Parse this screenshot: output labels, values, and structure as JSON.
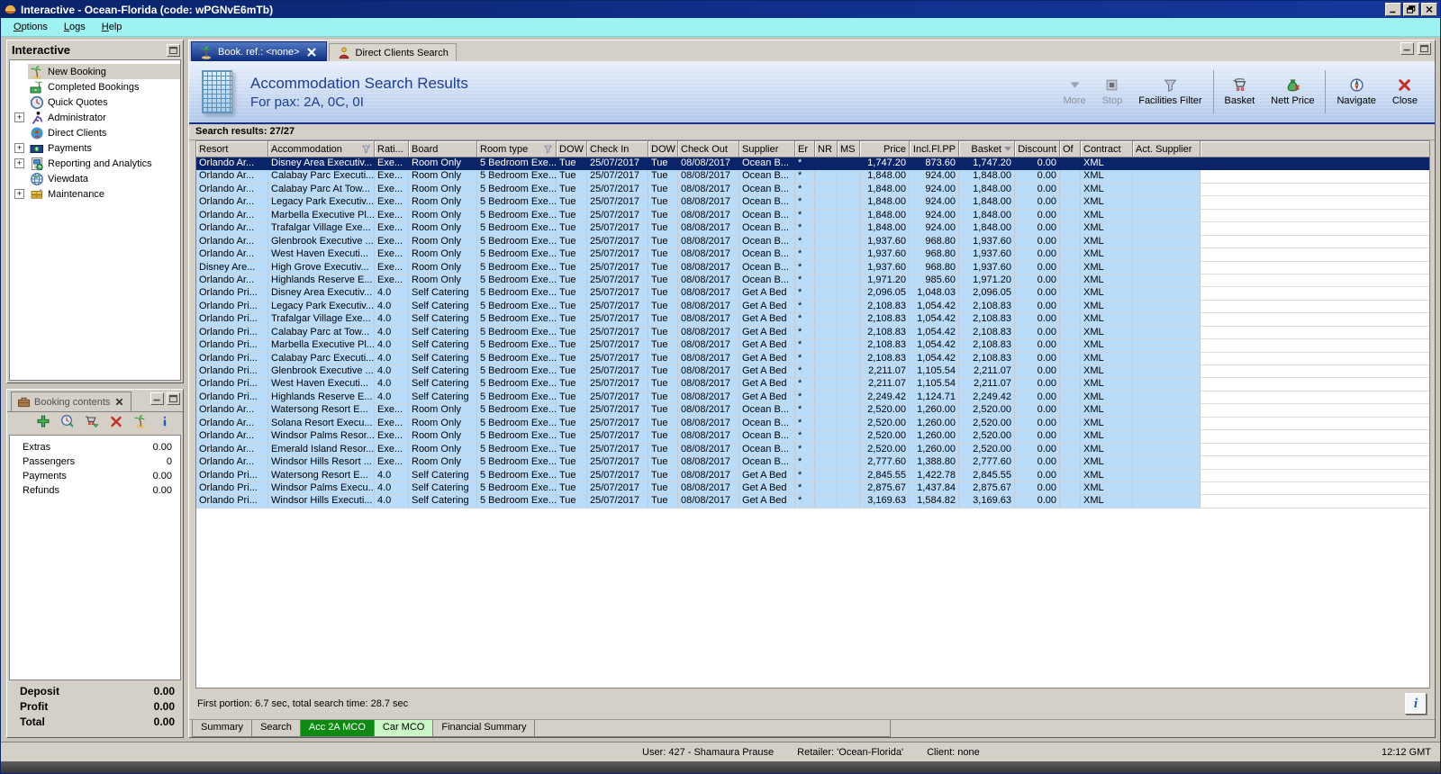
{
  "window": {
    "title": "Interactive - Ocean-Florida (code: wPGNvE6mTb)"
  },
  "menu": {
    "items": [
      {
        "label": "Options"
      },
      {
        "label": "Logs"
      },
      {
        "label": "Help"
      }
    ]
  },
  "sidebar": {
    "title": "Interactive",
    "items": [
      {
        "label": "New Booking",
        "icon": "palm",
        "selected": true
      },
      {
        "label": "Completed Bookings",
        "icon": "completed"
      },
      {
        "label": "Quick Quotes",
        "icon": "clock"
      },
      {
        "label": "Administrator",
        "icon": "admin",
        "expandable": true
      },
      {
        "label": "Direct Clients",
        "icon": "clients"
      },
      {
        "label": "Payments",
        "icon": "payments",
        "expandable": true
      },
      {
        "label": "Reporting and Analytics",
        "icon": "reporting",
        "expandable": true
      },
      {
        "label": "Viewdata",
        "icon": "globe"
      },
      {
        "label": "Maintenance",
        "icon": "maintenance",
        "expandable": true
      }
    ]
  },
  "booking_contents": {
    "title": "Booking contents",
    "toolbar_icons": [
      "add",
      "quote",
      "cart-add",
      "delete",
      "palm",
      "info"
    ],
    "rows": [
      [
        "Extras",
        "0.00"
      ],
      [
        "Passengers",
        "0"
      ],
      [
        "Payments",
        "0.00"
      ],
      [
        "Refunds",
        "0.00"
      ]
    ],
    "totals": [
      [
        "Deposit",
        "0.00"
      ],
      [
        "Profit",
        "0.00"
      ],
      [
        "Total",
        "0.00"
      ]
    ]
  },
  "main": {
    "tabs": [
      {
        "label": "Book. ref.: <none>",
        "icon": "palm",
        "closable": true,
        "active": true
      },
      {
        "label": "Direct Clients Search",
        "icon": "client-search",
        "active": false
      }
    ],
    "header": {
      "title": "Accommodation Search Results",
      "subtitle": "For pax: 2A, 0C, 0I"
    },
    "toolbar": [
      {
        "label": "More",
        "icon": "more",
        "disabled": true
      },
      {
        "label": "Stop",
        "icon": "stop",
        "disabled": true
      },
      {
        "label": "Facilities Filter",
        "icon": "funnel"
      },
      {
        "label": "Basket",
        "icon": "basket",
        "sep_before": true
      },
      {
        "label": "Nett Price",
        "icon": "nett"
      },
      {
        "label": "Navigate",
        "icon": "navigate",
        "sep_before": true
      },
      {
        "label": "Close",
        "icon": "close"
      }
    ],
    "results_label": "Search results: 27/27",
    "table": {
      "selected_index": 0,
      "headers": [
        {
          "label": "Resort"
        },
        {
          "label": "Accommodation",
          "filter": true
        },
        {
          "label": "Rati..."
        },
        {
          "label": "Board"
        },
        {
          "label": "Room type",
          "filter": true
        },
        {
          "label": "DOW"
        },
        {
          "label": "Check In"
        },
        {
          "label": "DOW"
        },
        {
          "label": "Check Out"
        },
        {
          "label": "Supplier"
        },
        {
          "label": "Er"
        },
        {
          "label": "NR"
        },
        {
          "label": "MS"
        },
        {
          "label": "Price"
        },
        {
          "label": "Incl.Fl.PP"
        },
        {
          "label": "Basket",
          "sort": true
        },
        {
          "label": "Discount"
        },
        {
          "label": "Of"
        },
        {
          "label": "Contract"
        },
        {
          "label": "Act. Supplier"
        }
      ],
      "rows": [
        [
          "Orlando Ar...",
          "Disney Area Executiv...",
          "Exe...",
          "Room Only",
          "5 Bedroom Exe...",
          "Tue",
          "25/07/2017",
          "Tue",
          "08/08/2017",
          "Ocean B...",
          "*",
          "",
          "",
          "1,747.20",
          "873.60",
          "1,747.20",
          "0.00",
          "",
          "XML",
          ""
        ],
        [
          "Orlando Ar...",
          "Calabay Parc Executi...",
          "Exe...",
          "Room Only",
          "5 Bedroom Exe...",
          "Tue",
          "25/07/2017",
          "Tue",
          "08/08/2017",
          "Ocean B...",
          "*",
          "",
          "",
          "1,848.00",
          "924.00",
          "1,848.00",
          "0.00",
          "",
          "XML",
          ""
        ],
        [
          "Orlando Ar...",
          "Calabay Parc At Tow...",
          "Exe...",
          "Room Only",
          "5 Bedroom Exe...",
          "Tue",
          "25/07/2017",
          "Tue",
          "08/08/2017",
          "Ocean B...",
          "*",
          "",
          "",
          "1,848.00",
          "924.00",
          "1,848.00",
          "0.00",
          "",
          "XML",
          ""
        ],
        [
          "Orlando Ar...",
          "Legacy Park Executiv...",
          "Exe...",
          "Room Only",
          "5 Bedroom Exe...",
          "Tue",
          "25/07/2017",
          "Tue",
          "08/08/2017",
          "Ocean B...",
          "*",
          "",
          "",
          "1,848.00",
          "924.00",
          "1,848.00",
          "0.00",
          "",
          "XML",
          ""
        ],
        [
          "Orlando Ar...",
          "Marbella Executive Pl...",
          "Exe...",
          "Room Only",
          "5 Bedroom Exe...",
          "Tue",
          "25/07/2017",
          "Tue",
          "08/08/2017",
          "Ocean B...",
          "*",
          "",
          "",
          "1,848.00",
          "924.00",
          "1,848.00",
          "0.00",
          "",
          "XML",
          ""
        ],
        [
          "Orlando Ar...",
          "Trafalgar Village Exe...",
          "Exe...",
          "Room Only",
          "5 Bedroom Exe...",
          "Tue",
          "25/07/2017",
          "Tue",
          "08/08/2017",
          "Ocean B...",
          "*",
          "",
          "",
          "1,848.00",
          "924.00",
          "1,848.00",
          "0.00",
          "",
          "XML",
          ""
        ],
        [
          "Orlando Ar...",
          "Glenbrook Executive ...",
          "Exe...",
          "Room Only",
          "5 Bedroom Exe...",
          "Tue",
          "25/07/2017",
          "Tue",
          "08/08/2017",
          "Ocean B...",
          "*",
          "",
          "",
          "1,937.60",
          "968.80",
          "1,937.60",
          "0.00",
          "",
          "XML",
          ""
        ],
        [
          "Orlando Ar...",
          "West Haven Executi...",
          "Exe...",
          "Room Only",
          "5 Bedroom Exe...",
          "Tue",
          "25/07/2017",
          "Tue",
          "08/08/2017",
          "Ocean B...",
          "*",
          "",
          "",
          "1,937.60",
          "968.80",
          "1,937.60",
          "0.00",
          "",
          "XML",
          ""
        ],
        [
          "Disney Are...",
          "High Grove Executiv...",
          "Exe...",
          "Room Only",
          "5 Bedroom Exe...",
          "Tue",
          "25/07/2017",
          "Tue",
          "08/08/2017",
          "Ocean B...",
          "*",
          "",
          "",
          "1,937.60",
          "968.80",
          "1,937.60",
          "0.00",
          "",
          "XML",
          ""
        ],
        [
          "Orlando Ar...",
          "Highlands Reserve E...",
          "Exe...",
          "Room Only",
          "5 Bedroom Exe...",
          "Tue",
          "25/07/2017",
          "Tue",
          "08/08/2017",
          "Ocean B...",
          "*",
          "",
          "",
          "1,971.20",
          "985.60",
          "1,971.20",
          "0.00",
          "",
          "XML",
          ""
        ],
        [
          "Orlando Pri...",
          "Disney Area Executiv...",
          "4.0",
          "Self Catering",
          "5 Bedroom Exe...",
          "Tue",
          "25/07/2017",
          "Tue",
          "08/08/2017",
          "Get A Bed",
          "*",
          "",
          "",
          "2,096.05",
          "1,048.03",
          "2,096.05",
          "0.00",
          "",
          "XML",
          ""
        ],
        [
          "Orlando Pri...",
          "Legacy Park Executiv...",
          "4.0",
          "Self Catering",
          "5 Bedroom Exe...",
          "Tue",
          "25/07/2017",
          "Tue",
          "08/08/2017",
          "Get A Bed",
          "*",
          "",
          "",
          "2,108.83",
          "1,054.42",
          "2,108.83",
          "0.00",
          "",
          "XML",
          ""
        ],
        [
          "Orlando Pri...",
          "Trafalgar Village Exe...",
          "4.0",
          "Self Catering",
          "5 Bedroom Exe...",
          "Tue",
          "25/07/2017",
          "Tue",
          "08/08/2017",
          "Get A Bed",
          "*",
          "",
          "",
          "2,108.83",
          "1,054.42",
          "2,108.83",
          "0.00",
          "",
          "XML",
          ""
        ],
        [
          "Orlando Pri...",
          "Calabay Parc at Tow...",
          "4.0",
          "Self Catering",
          "5 Bedroom Exe...",
          "Tue",
          "25/07/2017",
          "Tue",
          "08/08/2017",
          "Get A Bed",
          "*",
          "",
          "",
          "2,108.83",
          "1,054.42",
          "2,108.83",
          "0.00",
          "",
          "XML",
          ""
        ],
        [
          "Orlando Pri...",
          "Marbella Executive Pl...",
          "4.0",
          "Self Catering",
          "5 Bedroom Exe...",
          "Tue",
          "25/07/2017",
          "Tue",
          "08/08/2017",
          "Get A Bed",
          "*",
          "",
          "",
          "2,108.83",
          "1,054.42",
          "2,108.83",
          "0.00",
          "",
          "XML",
          ""
        ],
        [
          "Orlando Pri...",
          "Calabay Parc Executi...",
          "4.0",
          "Self Catering",
          "5 Bedroom Exe...",
          "Tue",
          "25/07/2017",
          "Tue",
          "08/08/2017",
          "Get A Bed",
          "*",
          "",
          "",
          "2,108.83",
          "1,054.42",
          "2,108.83",
          "0.00",
          "",
          "XML",
          ""
        ],
        [
          "Orlando Pri...",
          "Glenbrook Executive ...",
          "4.0",
          "Self Catering",
          "5 Bedroom Exe...",
          "Tue",
          "25/07/2017",
          "Tue",
          "08/08/2017",
          "Get A Bed",
          "*",
          "",
          "",
          "2,211.07",
          "1,105.54",
          "2,211.07",
          "0.00",
          "",
          "XML",
          ""
        ],
        [
          "Orlando Pri...",
          "West Haven Executi...",
          "4.0",
          "Self Catering",
          "5 Bedroom Exe...",
          "Tue",
          "25/07/2017",
          "Tue",
          "08/08/2017",
          "Get A Bed",
          "*",
          "",
          "",
          "2,211.07",
          "1,105.54",
          "2,211.07",
          "0.00",
          "",
          "XML",
          ""
        ],
        [
          "Orlando Pri...",
          "Highlands Reserve E...",
          "4.0",
          "Self Catering",
          "5 Bedroom Exe...",
          "Tue",
          "25/07/2017",
          "Tue",
          "08/08/2017",
          "Get A Bed",
          "*",
          "",
          "",
          "2,249.42",
          "1,124.71",
          "2,249.42",
          "0.00",
          "",
          "XML",
          ""
        ],
        [
          "Orlando Ar...",
          "Watersong Resort E...",
          "Exe...",
          "Room Only",
          "5 Bedroom Exe...",
          "Tue",
          "25/07/2017",
          "Tue",
          "08/08/2017",
          "Ocean B...",
          "*",
          "",
          "",
          "2,520.00",
          "1,260.00",
          "2,520.00",
          "0.00",
          "",
          "XML",
          ""
        ],
        [
          "Orlando Ar...",
          "Solana Resort Execu...",
          "Exe...",
          "Room Only",
          "5 Bedroom Exe...",
          "Tue",
          "25/07/2017",
          "Tue",
          "08/08/2017",
          "Ocean B...",
          "*",
          "",
          "",
          "2,520.00",
          "1,260.00",
          "2,520.00",
          "0.00",
          "",
          "XML",
          ""
        ],
        [
          "Orlando Ar...",
          "Windsor Palms Resor...",
          "Exe...",
          "Room Only",
          "5 Bedroom Exe...",
          "Tue",
          "25/07/2017",
          "Tue",
          "08/08/2017",
          "Ocean B...",
          "*",
          "",
          "",
          "2,520.00",
          "1,260.00",
          "2,520.00",
          "0.00",
          "",
          "XML",
          ""
        ],
        [
          "Orlando Ar...",
          "Emerald Island Resor...",
          "Exe...",
          "Room Only",
          "5 Bedroom Exe...",
          "Tue",
          "25/07/2017",
          "Tue",
          "08/08/2017",
          "Ocean B...",
          "*",
          "",
          "",
          "2,520.00",
          "1,260.00",
          "2,520.00",
          "0.00",
          "",
          "XML",
          ""
        ],
        [
          "Orlando Ar...",
          "Windsor Hills Resort ...",
          "Exe...",
          "Room Only",
          "5 Bedroom Exe...",
          "Tue",
          "25/07/2017",
          "Tue",
          "08/08/2017",
          "Ocean B...",
          "*",
          "",
          "",
          "2,777.60",
          "1,388.80",
          "2,777.60",
          "0.00",
          "",
          "XML",
          ""
        ],
        [
          "Orlando Pri...",
          "Watersong Resort E...",
          "4.0",
          "Self Catering",
          "5 Bedroom Exe...",
          "Tue",
          "25/07/2017",
          "Tue",
          "08/08/2017",
          "Get A Bed",
          "*",
          "",
          "",
          "2,845.55",
          "1,422.78",
          "2,845.55",
          "0.00",
          "",
          "XML",
          ""
        ],
        [
          "Orlando Pri...",
          "Windsor Palms Execu...",
          "4.0",
          "Self Catering",
          "5 Bedroom Exe...",
          "Tue",
          "25/07/2017",
          "Tue",
          "08/08/2017",
          "Get A Bed",
          "*",
          "",
          "",
          "2,875.67",
          "1,437.84",
          "2,875.67",
          "0.00",
          "",
          "XML",
          ""
        ],
        [
          "Orlando Pri...",
          "Windsor Hills Executi...",
          "4.0",
          "Self Catering",
          "5 Bedroom Exe...",
          "Tue",
          "25/07/2017",
          "Tue",
          "08/08/2017",
          "Get A Bed",
          "*",
          "",
          "",
          "3,169.63",
          "1,584.82",
          "3,169.63",
          "0.00",
          "",
          "XML",
          ""
        ]
      ]
    },
    "footer": {
      "status": "First portion: 6.7 sec, total search time: 28.7 sec",
      "info_button": "i"
    },
    "bottom_tabs": [
      {
        "label": "Summary"
      },
      {
        "label": "Search"
      },
      {
        "label": "Acc 2A MCO",
        "variant": "dark-green"
      },
      {
        "label": "Car MCO",
        "variant": "light-green"
      },
      {
        "label": "Financial Summary"
      }
    ]
  },
  "status_bar": {
    "user": "User: 427 - Shamaura Prause",
    "retailer": "Retailer: 'Ocean-Florida'",
    "client": "Client: none",
    "time": "12:12 GMT"
  }
}
